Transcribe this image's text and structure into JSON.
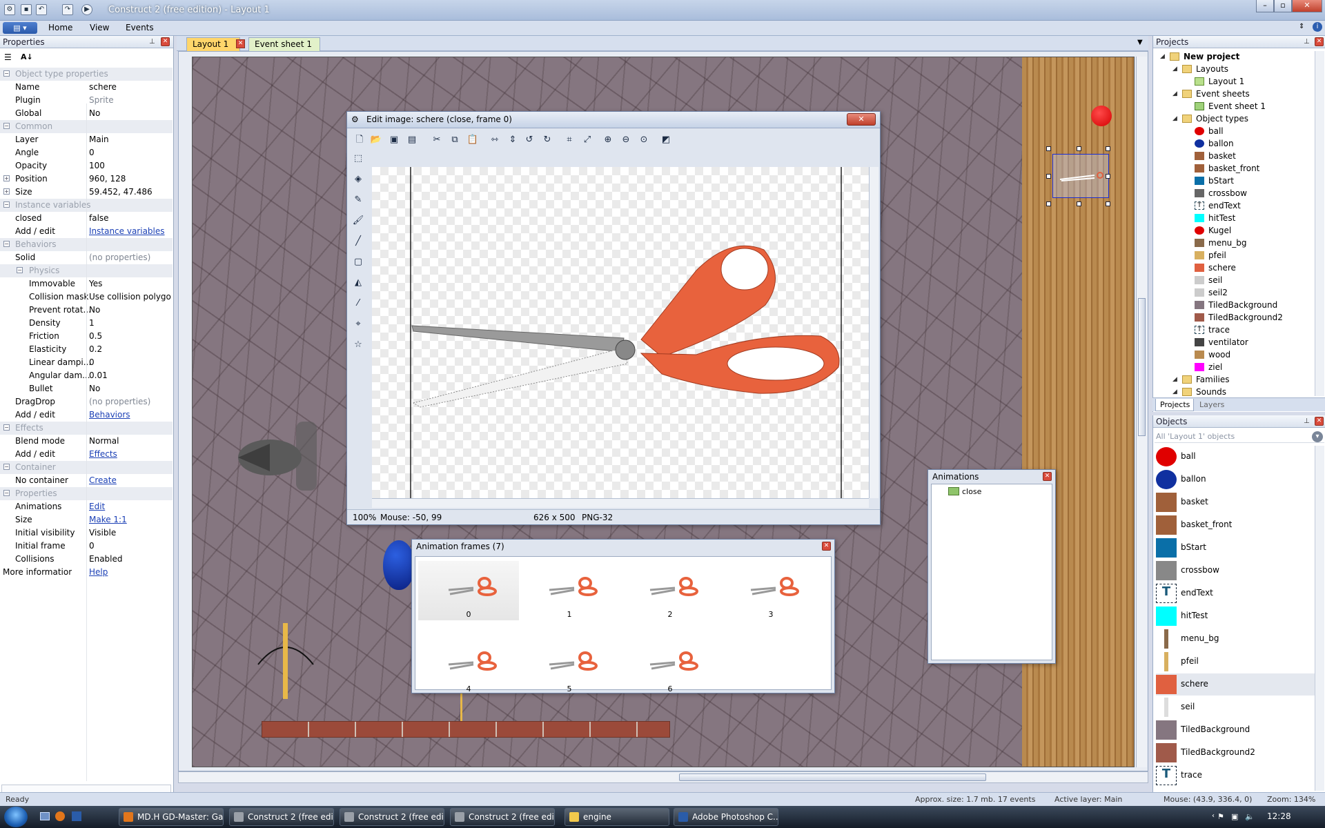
{
  "app": {
    "title": "Construct 2  (free edition) - Layout 1"
  },
  "ribbon": {
    "file_label": "▤ ▾",
    "tabs": [
      "Home",
      "View",
      "Events"
    ]
  },
  "properties_panel": {
    "title": "Properties",
    "rows": [
      {
        "type": "section",
        "label": "Object type properties"
      },
      {
        "type": "prop",
        "key": "Name",
        "value": "schere"
      },
      {
        "type": "prop",
        "key": "Plugin",
        "value": "Sprite",
        "muted": true
      },
      {
        "type": "prop",
        "key": "Global",
        "value": "No"
      },
      {
        "type": "section",
        "label": "Common"
      },
      {
        "type": "prop",
        "key": "Layer",
        "value": "Main"
      },
      {
        "type": "prop",
        "key": "Angle",
        "value": "0"
      },
      {
        "type": "prop",
        "key": "Opacity",
        "value": "100"
      },
      {
        "type": "prop",
        "key": "Position",
        "value": "960, 128",
        "expand": true
      },
      {
        "type": "prop",
        "key": "Size",
        "value": "59.452, 47.486",
        "expand": true
      },
      {
        "type": "section",
        "label": "Instance variables"
      },
      {
        "type": "prop",
        "key": "closed",
        "value": "false"
      },
      {
        "type": "prop",
        "key": "Add / edit",
        "value": "Instance variables",
        "link": true
      },
      {
        "type": "section",
        "label": "Behaviors"
      },
      {
        "type": "prop",
        "key": "Solid",
        "value": "(no properties)",
        "muted": true
      },
      {
        "type": "subsection",
        "label": "Physics"
      },
      {
        "type": "subprop",
        "key": "Immovable",
        "value": "Yes"
      },
      {
        "type": "subprop",
        "key": "Collision mask",
        "value": "Use collision polygon"
      },
      {
        "type": "subprop",
        "key": "Prevent rotat...",
        "value": "No"
      },
      {
        "type": "subprop",
        "key": "Density",
        "value": "1"
      },
      {
        "type": "subprop",
        "key": "Friction",
        "value": "0.5"
      },
      {
        "type": "subprop",
        "key": "Elasticity",
        "value": "0.2"
      },
      {
        "type": "subprop",
        "key": "Linear dampi...",
        "value": "0"
      },
      {
        "type": "subprop",
        "key": "Angular dam...",
        "value": "0.01"
      },
      {
        "type": "subprop",
        "key": "Bullet",
        "value": "No"
      },
      {
        "type": "prop",
        "key": "DragDrop",
        "value": "(no properties)",
        "muted": true
      },
      {
        "type": "prop",
        "key": "Add / edit",
        "value": "Behaviors",
        "link": true
      },
      {
        "type": "section",
        "label": "Effects"
      },
      {
        "type": "prop",
        "key": "Blend mode",
        "value": "Normal"
      },
      {
        "type": "prop",
        "key": "Add / edit",
        "value": "Effects",
        "link": true
      },
      {
        "type": "section",
        "label": "Container"
      },
      {
        "type": "prop",
        "key": "No container",
        "value": "Create",
        "link": true
      },
      {
        "type": "section",
        "label": "Properties"
      },
      {
        "type": "prop",
        "key": "Animations",
        "value": "Edit",
        "link": true
      },
      {
        "type": "prop",
        "key": "Size",
        "value": "Make 1:1",
        "link": true
      },
      {
        "type": "prop",
        "key": "Initial visibility",
        "value": "Visible"
      },
      {
        "type": "prop",
        "key": "Initial frame",
        "value": "0"
      },
      {
        "type": "prop",
        "key": "Collisions",
        "value": "Enabled"
      },
      {
        "type": "prop",
        "key": "More information",
        "value": "Help",
        "link": true,
        "nokeyindent": true
      }
    ]
  },
  "doc_tabs": [
    "Layout 1",
    "Event sheet 1"
  ],
  "edit_image": {
    "title": "Edit image: schere (close, frame 0)",
    "status_zoom": "100%",
    "status_mouse": "Mouse: -50, 99",
    "status_size": "626 x 500",
    "status_format": "PNG-32"
  },
  "animation_frames": {
    "title": "Animation frames (7)",
    "frames": [
      "0",
      "1",
      "2",
      "3",
      "4",
      "5",
      "6"
    ]
  },
  "animations": {
    "title": "Animations",
    "items": [
      "close"
    ]
  },
  "projects_panel": {
    "title": "Projects",
    "tree": [
      {
        "label": "New project",
        "level": 0,
        "bold": true,
        "icon": "folder"
      },
      {
        "label": "Layouts",
        "level": 1,
        "icon": "folder"
      },
      {
        "label": "Layout 1",
        "level": 2,
        "icon": "layout"
      },
      {
        "label": "Event sheets",
        "level": 1,
        "icon": "folder"
      },
      {
        "label": "Event sheet 1",
        "level": 2,
        "icon": "eventsheet"
      },
      {
        "label": "Object types",
        "level": 1,
        "icon": "folder"
      },
      {
        "label": "ball",
        "level": 2,
        "icon": "#e00000"
      },
      {
        "label": "ballon",
        "level": 2,
        "icon": "#1030a0"
      },
      {
        "label": "basket",
        "level": 2,
        "icon": "#a0603a"
      },
      {
        "label": "basket_front",
        "level": 2,
        "icon": "#a0603a"
      },
      {
        "label": "bStart",
        "level": 2,
        "icon": "#0a6fa8"
      },
      {
        "label": "crossbow",
        "level": 2,
        "icon": "#666666"
      },
      {
        "label": "endText",
        "level": 2,
        "icon": "text"
      },
      {
        "label": "hitTest",
        "level": 2,
        "icon": "#00ffff"
      },
      {
        "label": "Kugel",
        "level": 2,
        "icon": "#e00000"
      },
      {
        "label": "menu_bg",
        "level": 2,
        "icon": "#8a6a4a"
      },
      {
        "label": "pfeil",
        "level": 2,
        "icon": "#d8b060"
      },
      {
        "label": "schere",
        "level": 2,
        "icon": "#e06040"
      },
      {
        "label": "seil",
        "level": 2,
        "icon": "#cccccc"
      },
      {
        "label": "seil2",
        "level": 2,
        "icon": "#cccccc"
      },
      {
        "label": "TiledBackground",
        "level": 2,
        "icon": "#857680"
      },
      {
        "label": "TiledBackground2",
        "level": 2,
        "icon": "#a05a4a"
      },
      {
        "label": "trace",
        "level": 2,
        "icon": "text"
      },
      {
        "label": "ventilator",
        "level": 2,
        "icon": "#444444"
      },
      {
        "label": "wood",
        "level": 2,
        "icon": "#b98a4f"
      },
      {
        "label": "ziel",
        "level": 2,
        "icon": "#ff00ff"
      },
      {
        "label": "Families",
        "level": 1,
        "icon": "folder"
      },
      {
        "label": "Sounds",
        "level": 1,
        "icon": "folder"
      }
    ],
    "tabs": [
      "Projects",
      "Layers"
    ]
  },
  "objects_panel": {
    "title": "Objects",
    "filter": "All 'Layout 1' objects",
    "items": [
      {
        "label": "ball",
        "color": "#e00000"
      },
      {
        "label": "ballon",
        "color": "#1030a0"
      },
      {
        "label": "basket",
        "color": "#a0603a"
      },
      {
        "label": "basket_front",
        "color": "#a0603a"
      },
      {
        "label": "bStart",
        "color": "#0a6fa8"
      },
      {
        "label": "crossbow",
        "color": "#888888"
      },
      {
        "label": "endText",
        "color": "text"
      },
      {
        "label": "hitTest",
        "color": "#00ffff"
      },
      {
        "label": "menu_bg",
        "color": "#8a6a4a"
      },
      {
        "label": "pfeil",
        "color": "#d8b060"
      },
      {
        "label": "schere",
        "color": "#e06040"
      },
      {
        "label": "seil",
        "color": "#dddddd"
      },
      {
        "label": "TiledBackground",
        "color": "#857680"
      },
      {
        "label": "TiledBackground2",
        "color": "#a05a4a"
      },
      {
        "label": "trace",
        "color": "text"
      }
    ]
  },
  "statusbar": {
    "ready": "Ready",
    "approx": "Approx. size: 1.7 mb. 17 events",
    "layer": "Active layer: Main",
    "mouse": "Mouse: (43.9, 336.4, 0)",
    "zoom": "Zoom: 134%"
  },
  "taskbar": {
    "tasks": [
      {
        "label": "MD.H GD-Master: Ga...",
        "color": "#e2761b"
      },
      {
        "label": "Construct 2  (free edi...",
        "color": "#9aa0a8"
      },
      {
        "label": "Construct 2  (free edi...",
        "color": "#9aa0a8"
      },
      {
        "label": "Construct 2  (free edi...",
        "color": "#9aa0a8"
      },
      {
        "label": "engine",
        "color": "#f2c94c"
      },
      {
        "label": "Adobe Photoshop C...",
        "color": "#2a5ca8"
      }
    ],
    "clock": "12:28"
  }
}
